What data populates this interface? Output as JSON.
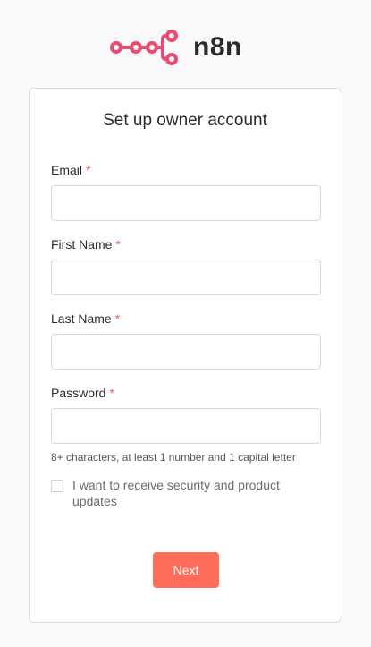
{
  "brand": {
    "name": "n8n",
    "logo_icon": "n8n-logo-icon",
    "logo_color": "#ea4b71"
  },
  "form": {
    "title": "Set up owner account",
    "required_marker": "*",
    "fields": [
      {
        "label": "Email",
        "value": "",
        "placeholder": ""
      },
      {
        "label": "First Name",
        "value": "",
        "placeholder": ""
      },
      {
        "label": "Last Name",
        "value": "",
        "placeholder": ""
      },
      {
        "label": "Password",
        "value": "",
        "placeholder": ""
      }
    ],
    "password_hint": "8+ characters, at least 1 number and 1 capital letter",
    "consent_label": "I want to receive security and product updates",
    "consent_checked": false,
    "next_label": "Next"
  },
  "colors": {
    "accent": "#ff6d5a",
    "required": "#f45a5a",
    "background": "#f9f9fb"
  }
}
